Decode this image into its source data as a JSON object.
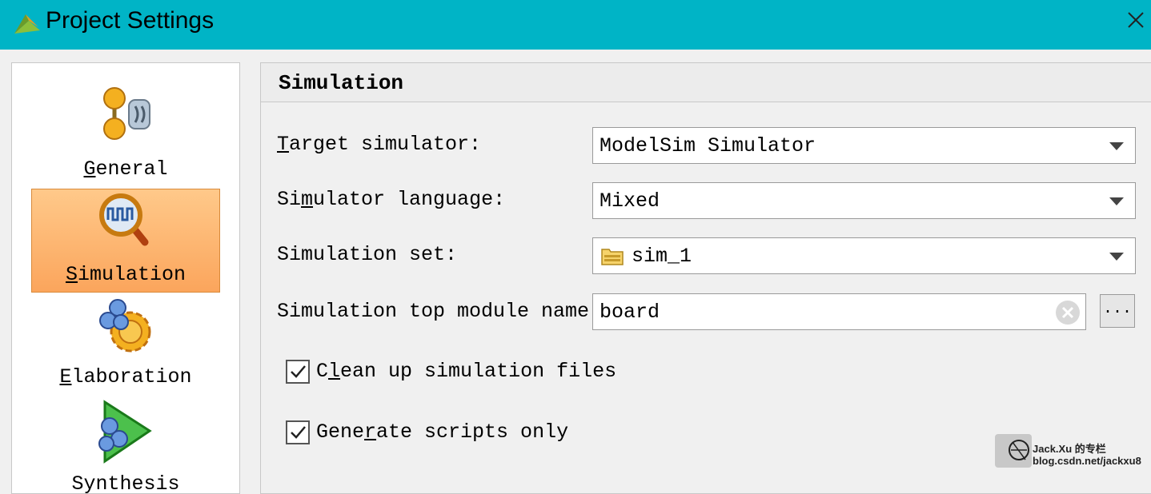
{
  "window": {
    "title": "Project Settings"
  },
  "sidebar": {
    "items": [
      {
        "label_pre": "",
        "label_key": "G",
        "label_post": "eneral",
        "icon": "general-icon"
      },
      {
        "label_pre": "",
        "label_key": "S",
        "label_post": "imulation",
        "icon": "simulation-icon",
        "selected": true
      },
      {
        "label_pre": "",
        "label_key": "E",
        "label_post": "laboration",
        "icon": "elaboration-icon"
      },
      {
        "label_pre": "Synthesis",
        "icon": "synthesis-icon"
      }
    ]
  },
  "panel": {
    "title": "Simulation",
    "target_simulator": {
      "label_key": "T",
      "label_post": "arget simulator:",
      "value": "ModelSim Simulator"
    },
    "simulator_language": {
      "label_pre": "Si",
      "label_key": "m",
      "label_post": "ulator language:",
      "value": "Mixed"
    },
    "simulation_set": {
      "label": "Simulation set:",
      "value": "sim_1"
    },
    "top_module": {
      "label": "Simulation top module name:",
      "value": "board",
      "browse_label": "..."
    },
    "clean_up": {
      "label_pre": "C",
      "label_key": "l",
      "label_post": "ean up simulation files",
      "checked": true
    },
    "generate_scripts": {
      "label_pre": "Gene",
      "label_key": "r",
      "label_post": "ate scripts only",
      "checked": true
    }
  },
  "watermark": {
    "line1": "Jack.Xu 的专栏",
    "line2": "blog.csdn.net/jackxu8"
  },
  "colors": {
    "titlebar": "#00b4c6",
    "selected": "#fba55c"
  }
}
